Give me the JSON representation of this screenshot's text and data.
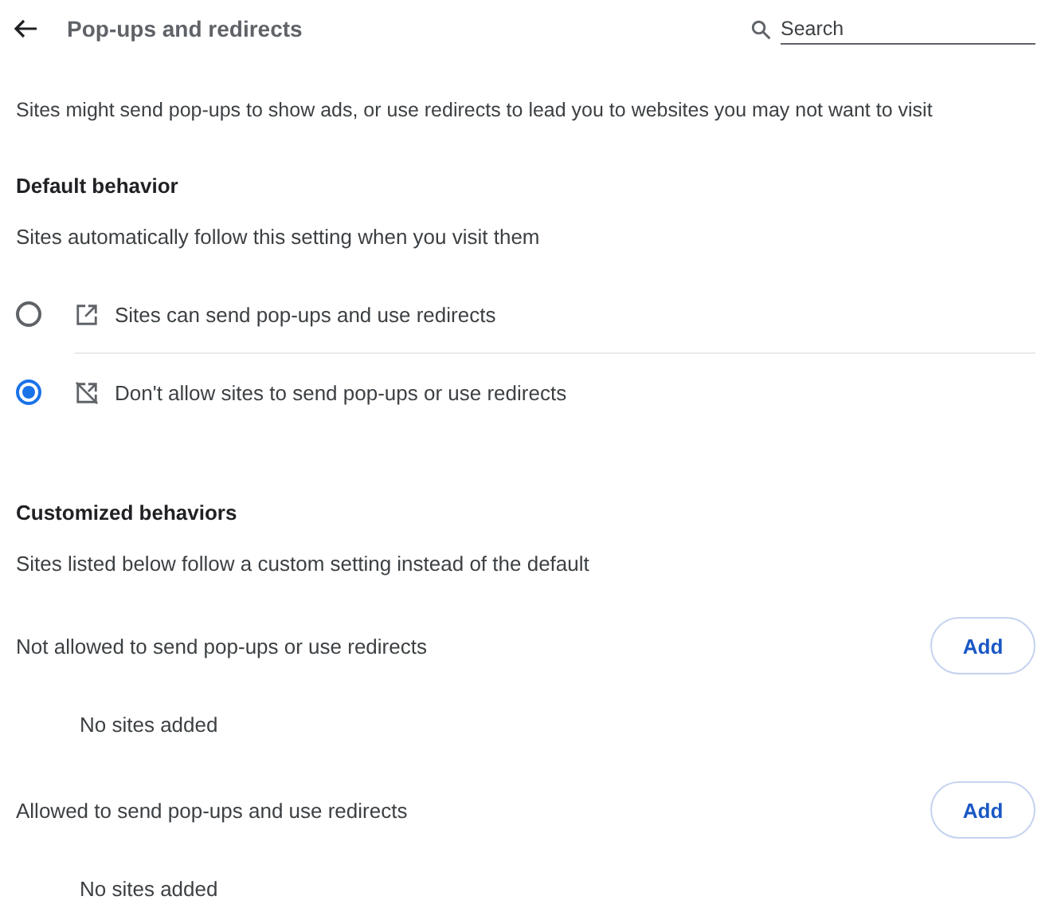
{
  "header": {
    "title": "Pop-ups and redirects",
    "search": {
      "placeholder": "Search"
    }
  },
  "description": "Sites might send pop-ups to show ads, or use redirects to lead you to websites you may not want to visit",
  "default_behavior": {
    "heading": "Default behavior",
    "subtitle": "Sites automatically follow this setting when you visit them",
    "options": [
      {
        "kind": "allow",
        "label": "Sites can send pop-ups and use redirects",
        "selected": false
      },
      {
        "kind": "block",
        "label": "Don't allow sites to send pop-ups or use redirects",
        "selected": true
      }
    ]
  },
  "customized_behaviors": {
    "heading": "Customized behaviors",
    "subtitle": "Sites listed below follow a custom setting instead of the default",
    "lists": [
      {
        "label": "Not allowed to send pop-ups or use redirects",
        "button": "Add",
        "empty_text": "No sites added"
      },
      {
        "label": "Allowed to send pop-ups and use redirects",
        "button": "Add",
        "empty_text": "No sites added"
      }
    ]
  }
}
